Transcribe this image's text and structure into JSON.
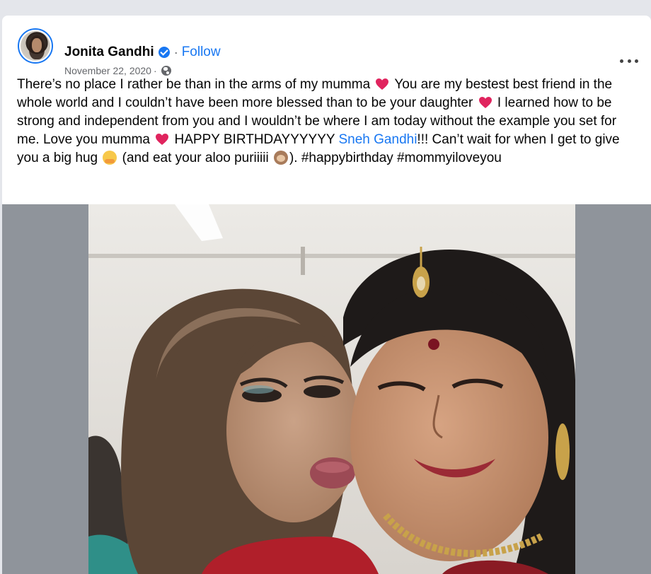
{
  "post": {
    "author": "Jonita Gandhi",
    "separator": "·",
    "follow_label": "Follow",
    "date": "November 22, 2020",
    "text_parts": {
      "p1": "There’s no place I rather be than in the arms of my mumma",
      "p2": "You are my bestest best friend in the whole world and I couldn’t have been more blessed than to be your daughter",
      "p3": "I learned how to be strong and independent from you and I wouldn’t be where I am today without the example you set for me. Love you mumma",
      "p4": "HAPPY BIRTHDAYYYYYY",
      "mention": "Sneh Gandhi",
      "p5": "!!! Can’t wait for when I get to give you a big hug",
      "p6": "(and eat your aloo puriiiii",
      "p7": "). #happybirthday #mommyiloveyou"
    }
  },
  "icons": {
    "verified": "verified-badge-icon",
    "privacy": "globe-icon",
    "more": "more-options-icon",
    "heart": "red-heart-emoji",
    "hug": "hugging-face-emoji",
    "monkey": "see-no-evil-monkey-emoji"
  },
  "colors": {
    "accent": "#1877f2",
    "heart": "#e0245e",
    "photo_backdrop": "#8f949b"
  }
}
